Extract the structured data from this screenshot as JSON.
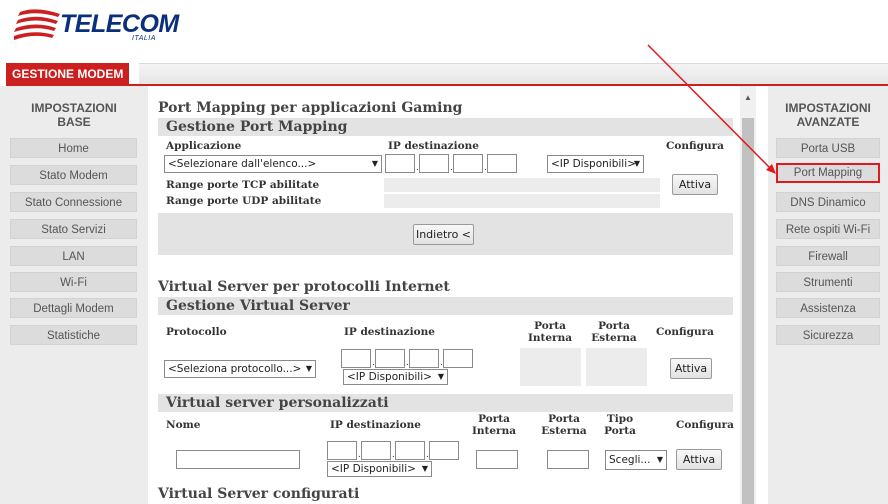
{
  "brand": {
    "name": "TELECOM",
    "sub": "ITALIA",
    "color": "#0b2f7a",
    "accent": "#cc1f1f"
  },
  "header": {
    "tab_label": "GESTIONE MODEM"
  },
  "left_panel": {
    "title_line1": "IMPOSTAZIONI",
    "title_line2": "BASE",
    "items": [
      "Home",
      "Stato Modem",
      "Stato Connessione",
      "Stato Servizi",
      "LAN",
      "Wi-Fi",
      "Dettagli Modem",
      "Statistiche"
    ]
  },
  "right_panel": {
    "title_line1": "IMPOSTAZIONI",
    "title_line2": "AVANZATE",
    "items": [
      "Porta USB",
      "Port Mapping",
      "DNS Dinamico",
      "Rete ospiti Wi-Fi",
      "Firewall",
      "Strumenti",
      "Assistenza",
      "Sicurezza"
    ],
    "active": "Port Mapping"
  },
  "port_mapping": {
    "title": "Port Mapping per applicazioni Gaming",
    "subhead": "Gestione Port Mapping",
    "col_app": "Applicazione",
    "col_ip": "IP destinazione",
    "col_config": "Configura",
    "app_select": "<Selezionare dall'elenco...>",
    "ip_select": "<IP Disponibili>",
    "tcp_label": "Range porte TCP abilitate",
    "udp_label": "Range porte UDP abilitate",
    "activate": "Attiva",
    "back": "Indietro <"
  },
  "virtual_server": {
    "title": "Virtual Server per protocolli Internet",
    "subhead": "Gestione Virtual Server",
    "col_protocol": "Protocollo",
    "col_ip": "IP destinazione",
    "col_port_int_1": "Porta",
    "col_port_int_2": "Interna",
    "col_port_ext_1": "Porta",
    "col_port_ext_2": "Esterna",
    "col_config": "Configura",
    "protocol_select": "<Seleziona protocollo...>",
    "ip_select": "<IP Disponibili>",
    "activate": "Attiva"
  },
  "custom_servers": {
    "subhead": "Virtual server personalizzati",
    "col_name": "Nome",
    "col_ip": "IP destinazione",
    "col_port_int_1": "Porta",
    "col_port_int_2": "Interna",
    "col_port_ext_1": "Porta",
    "col_port_ext_2": "Esterna",
    "col_type_1": "Tipo",
    "col_type_2": "Porta",
    "col_config": "Configura",
    "ip_select": "<IP Disponibili>",
    "type_select": "Scegli...",
    "activate": "Attiva"
  },
  "configured": {
    "title": "Virtual Server configurati"
  }
}
